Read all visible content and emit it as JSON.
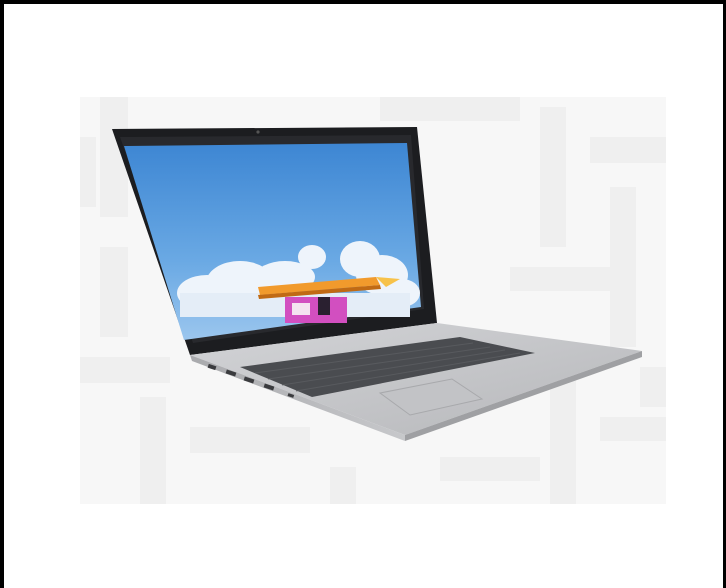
{
  "image": {
    "subject": "laptop-product-photo",
    "colors": {
      "background": "#ffffff",
      "border": "#000000",
      "backdrop": "#f7f7f7",
      "maze_pattern": "#eeeeee",
      "body_silver": "#c9cacc",
      "bezel": "#1c1d20",
      "sky": "#4f92d6",
      "keyboard": "#4a4c50",
      "roof": "#f19a2c",
      "building": "#d24fc0"
    }
  }
}
